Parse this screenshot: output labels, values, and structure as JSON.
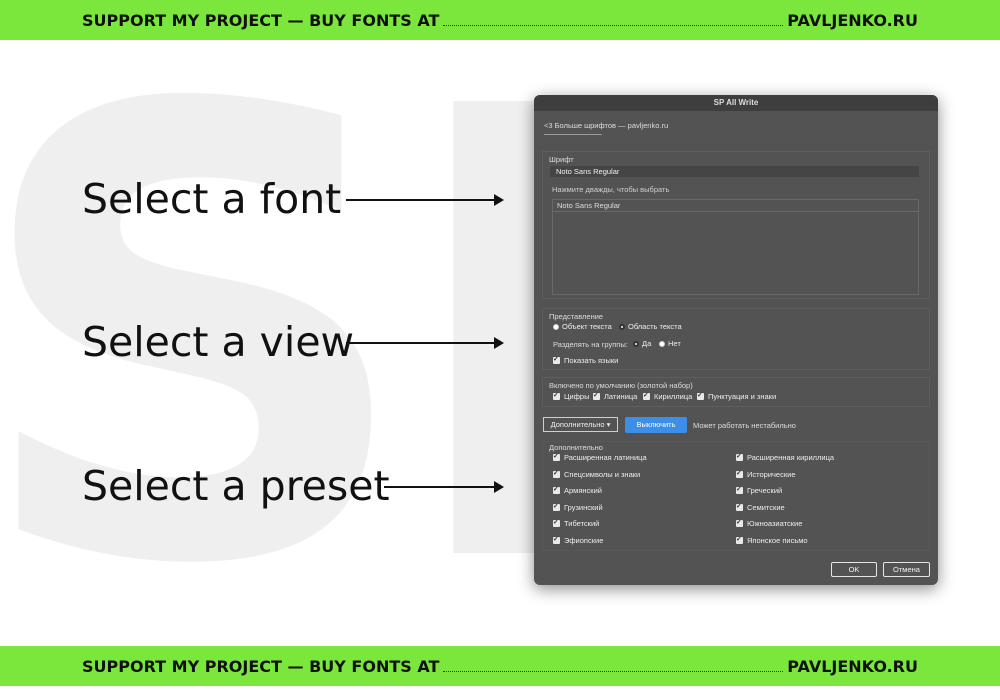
{
  "banner": {
    "left_text": "SUPPORT MY PROJECT — BUY FONTS AT",
    "right_text": "PAVLJENKO.RU"
  },
  "callouts": [
    "Select a font",
    "Select a view",
    "Select a preset"
  ],
  "dialog": {
    "title": "SP All Write",
    "link": "<3 Больше шрифтов — pavljenko.ru",
    "font_section": {
      "label": "Шрифт",
      "selected_font": "Noto Sans Regular",
      "hint": "Нажмите дважды, чтобы выбрать",
      "list": [
        "Noto Sans Regular"
      ]
    },
    "view_section": {
      "label": "Представление",
      "options": [
        "Объект текста",
        "Область текста"
      ],
      "selected": "Область текста",
      "group_label": "Разделять на группы:",
      "group_options": [
        "Да",
        "Нет"
      ],
      "group_selected": "Да",
      "show_languages": "Показать языки"
    },
    "default_section": {
      "label": "Включено по умолчанию (золотой набор)",
      "items": [
        "Цифры",
        "Латиница",
        "Кириллица",
        "Пунктуация и знаки"
      ]
    },
    "actions": {
      "more_label": "Дополнительно",
      "disable_label": "Выключить",
      "warning": "Может работать нестабильно"
    },
    "extra_section": {
      "label": "Дополнительно",
      "left": [
        "Расширенная латиница",
        "Спецсимволы и знаки",
        "Армянский",
        "Грузинский",
        "Тибетский",
        "Эфиопские"
      ],
      "right": [
        "Расширенная кириллица",
        "Исторические",
        "Греческий",
        "Семитские",
        "Южноазиатские",
        "Японское письмо"
      ]
    },
    "ok_label": "OK",
    "cancel_label": "Отмена"
  },
  "colors": {
    "banner": "#7be63c",
    "dialog_bg": "#535353",
    "accent_blue": "#3d8ee6"
  }
}
